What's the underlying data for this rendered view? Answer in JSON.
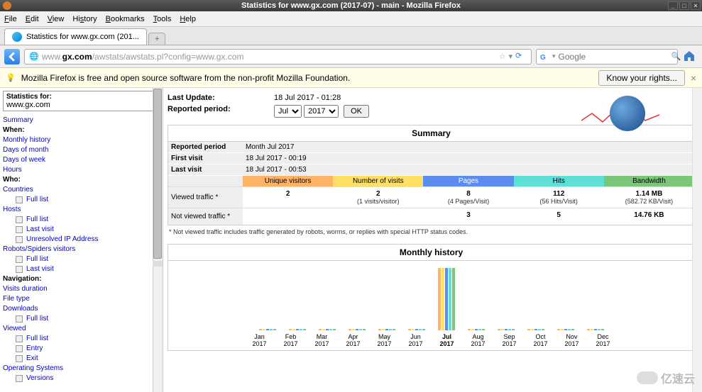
{
  "window": {
    "title": "Statistics for www.gx.com (2017-07) - main - Mozilla Firefox"
  },
  "menu": [
    "File",
    "Edit",
    "View",
    "History",
    "Bookmarks",
    "Tools",
    "Help"
  ],
  "tab": {
    "title": "Statistics for www.gx.com (201..."
  },
  "url": {
    "pre": "www.",
    "bold": "gx.com",
    "post": "/awstats/awstats.pl?config=www.gx.com"
  },
  "search": {
    "placeholder": "Google"
  },
  "notif": {
    "msg": "Mozilla Firefox is free and open source software from the non-profit Mozilla Foundation.",
    "btn": "Know your rights..."
  },
  "sidebar": {
    "stats_label": "Statistics for:",
    "stats_value": "www.gx.com",
    "links": {
      "summary": "Summary",
      "when": "When:",
      "monthly": "Monthly history",
      "dom": "Days of month",
      "dow": "Days of week",
      "hours": "Hours",
      "who": "Who:",
      "countries": "Countries",
      "full": "Full list",
      "hosts": "Hosts",
      "lastvisit": "Last visit",
      "unresolved": "Unresolved IP Address",
      "robots": "Robots/Spiders visitors",
      "nav": "Navigation:",
      "visitsdur": "Visits duration",
      "filetype": "File type",
      "downloads": "Downloads",
      "viewed": "Viewed",
      "entry": "Entry",
      "exit": "Exit",
      "os": "Operating Systems",
      "versions": "Versions"
    }
  },
  "main": {
    "last_update_label": "Last Update:",
    "last_update": "18 Jul 2017 - 01:28",
    "reported_label": "Reported period:",
    "month": "Jul",
    "year": "2017",
    "ok": "OK",
    "summary_title": "Summary",
    "meta": {
      "rp_label": "Reported period",
      "rp": "Month Jul 2017",
      "fv_label": "First visit",
      "fv": "18 Jul 2017 - 00:19",
      "lv_label": "Last visit",
      "lv": "18 Jul 2017 - 00:53"
    },
    "headers": {
      "uv": "Unique visitors",
      "nv": "Number of visits",
      "pg": "Pages",
      "ht": "Hits",
      "bw": "Bandwidth"
    },
    "viewed": {
      "label": "Viewed traffic *",
      "uv": "2",
      "nv": "2",
      "nv_sub": "(1 visits/visitor)",
      "pg": "8",
      "pg_sub": "(4 Pages/Visit)",
      "ht": "112",
      "ht_sub": "(56 Hits/Visit)",
      "bw": "1.14 MB",
      "bw_sub": "(582.72 KB/Visit)"
    },
    "notviewed": {
      "label": "Not viewed traffic *",
      "pg": "3",
      "ht": "5",
      "bw": "14.76 KB"
    },
    "footnote": "* Not viewed traffic includes traffic generated by robots, worms, or replies with special HTTP status codes.",
    "monthly_title": "Monthly history"
  },
  "chart_data": {
    "type": "bar",
    "categories": [
      "Jan 2017",
      "Feb 2017",
      "Mar 2017",
      "Apr 2017",
      "May 2017",
      "Jun 2017",
      "Jul 2017",
      "Aug 2017",
      "Sep 2017",
      "Oct 2017",
      "Nov 2017",
      "Dec 2017"
    ],
    "series": [
      {
        "name": "Unique visitors",
        "color": "#ffb366",
        "values": [
          0,
          0,
          0,
          0,
          0,
          0,
          2,
          0,
          0,
          0,
          0,
          0
        ]
      },
      {
        "name": "Number of visits",
        "color": "#ffe066",
        "values": [
          0,
          0,
          0,
          0,
          0,
          0,
          2,
          0,
          0,
          0,
          0,
          0
        ]
      },
      {
        "name": "Pages",
        "color": "#5b8def",
        "values": [
          0,
          0,
          0,
          0,
          0,
          0,
          8,
          0,
          0,
          0,
          0,
          0
        ]
      },
      {
        "name": "Hits",
        "color": "#5ee0d8",
        "values": [
          0,
          0,
          0,
          0,
          0,
          0,
          112,
          0,
          0,
          0,
          0,
          0
        ]
      },
      {
        "name": "Bandwidth",
        "color": "#7cc67c",
        "values": [
          0,
          0,
          0,
          0,
          0,
          0,
          1167523,
          0,
          0,
          0,
          0,
          0
        ]
      }
    ],
    "current_index": 6
  },
  "watermark": "亿速云"
}
